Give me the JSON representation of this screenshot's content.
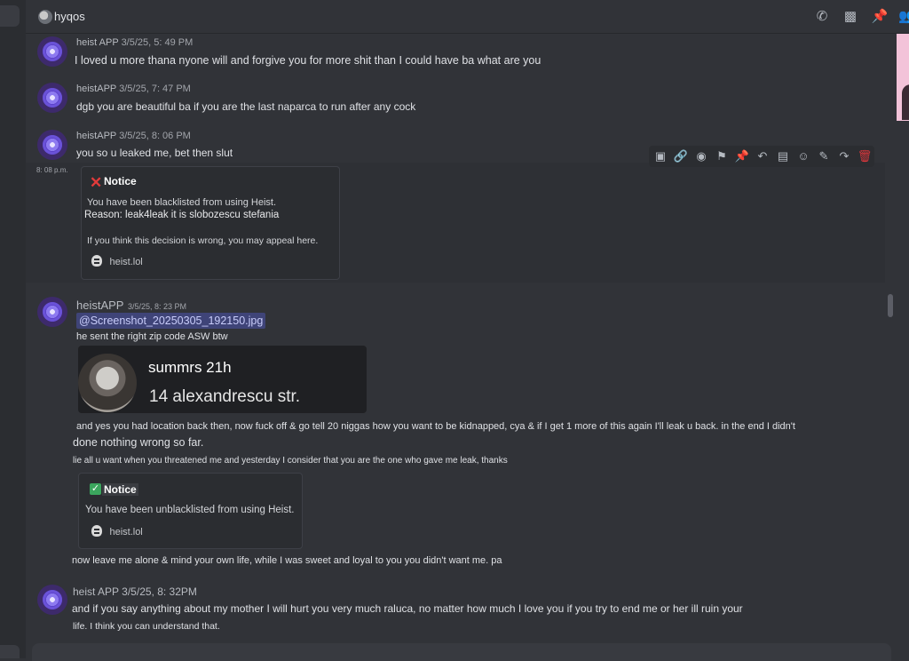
{
  "header": {
    "channel_name": "hyqos",
    "icons": [
      "phone-icon",
      "video-icon",
      "pin-icon",
      "members-icon"
    ]
  },
  "toolbar": {
    "icons": [
      "copy-id-icon",
      "link-icon",
      "thread-icon",
      "bookmark-icon",
      "pin-icon",
      "reply-icon",
      "text-icon",
      "emoji-icon",
      "edit-icon",
      "forward-icon",
      "delete-icon"
    ],
    "delete_color": "#da373c"
  },
  "messages": [
    {
      "author": "heist APP",
      "timestamp": "3/5/25, 5: 49 PM",
      "text": "I loved u more thana nyone will and forgive you for more shit than I could have ba what are you"
    },
    {
      "author": "heistAPP",
      "timestamp": "3/5/25, 7: 47 PM",
      "text": "dgb you are beautiful ba if you are the last naparca to run after any cock"
    },
    {
      "author": "heistAPP",
      "timestamp": "3/5/25, 8: 06 PM",
      "text": "you so u leaked me, bet then slut"
    }
  ],
  "notice1": {
    "time": "8: 08 p.m.",
    "title": "Notice",
    "line1": "You have been blacklisted from using Heist.",
    "reason": "Reason: leak4leak it is slobozescu stefania",
    "appeal": "If you think this decision is wrong, you may appeal here.",
    "footer": "heist.lol"
  },
  "message4": {
    "author": "heistAPP",
    "timestamp": "3/5/25, 8: 23 PM",
    "attachment": "@Screenshot_20250305_192150.jpg",
    "line1": "he sent the right zip code ASW btw",
    "card_name": "summrs 21h",
    "card_address": "14 alexandrescu str.",
    "line2": "and yes you had location back then, now fuck off & go tell 20 niggas how you want to be kidnapped, cya & if I get 1 more of this again I'll leak u back. in the end I didn't",
    "line3": "done nothing wrong so far.",
    "line4": "lie all u want when you threatened me and yesterday I consider that you are the one who gave me leak, thanks"
  },
  "notice2": {
    "title": "Notice",
    "line1": "You have been unblacklisted from using Heist.",
    "footer": "heist.lol"
  },
  "message5": {
    "text": "now leave me alone & mind your own life, while I was sweet and loyal to you you didn't want me. pa"
  },
  "message6": {
    "author": "heist APP",
    "timestamp": "3/5/25, 8: 32PM",
    "line1": "and if you say anything about my mother I will hurt you very much raluca, no matter how much I love you if you try to end me or her ill ruin your",
    "line2": "life. I think you can understand that."
  }
}
